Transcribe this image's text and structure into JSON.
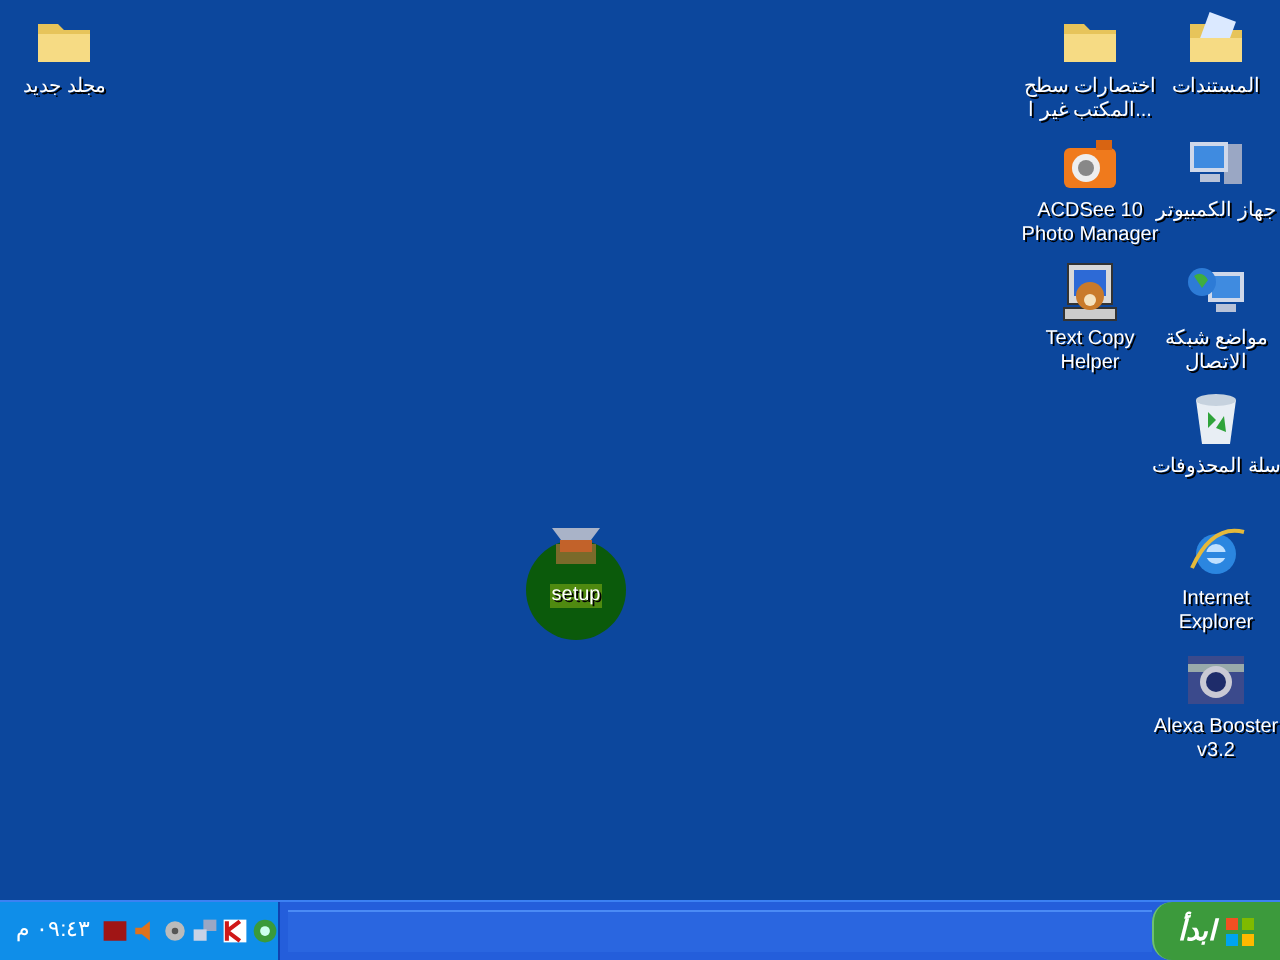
{
  "desktop_icons": [
    {
      "kind": "documents",
      "lines": [
        "المستندات"
      ],
      "selected": false
    },
    {
      "kind": "folder",
      "lines": [
        "اختصارات سطح",
        "المكتب غير ا..."
      ],
      "selected": false
    },
    {
      "kind": "computer",
      "lines": [
        "جهاز الكمبيوتر"
      ],
      "selected": false
    },
    {
      "kind": "camera",
      "lines": [
        "ACDSee 10",
        "Photo Manager"
      ],
      "selected": false
    },
    {
      "kind": "network",
      "lines": [
        "مواضع شبكة",
        "الاتصال"
      ],
      "selected": false
    },
    {
      "kind": "helper",
      "lines": [
        "Text Copy",
        "Helper"
      ],
      "selected": false
    },
    {
      "kind": "recycle",
      "lines": [
        "سلة المحذوفات"
      ],
      "selected": false
    },
    {
      "kind": "browser",
      "lines": [
        "Internet",
        "Explorer"
      ],
      "selected": false
    },
    {
      "kind": "booster",
      "lines": [
        "Alexa Booster",
        "v3.2"
      ],
      "selected": false
    },
    {
      "kind": "folder",
      "lines": [
        "مجلد جديد"
      ],
      "selected": false
    },
    {
      "kind": "setup",
      "lines": [
        "setup"
      ],
      "selected": true
    }
  ],
  "taskbar": {
    "clock": "٠٩:٤٣ م",
    "start_button": "ابدأ"
  }
}
